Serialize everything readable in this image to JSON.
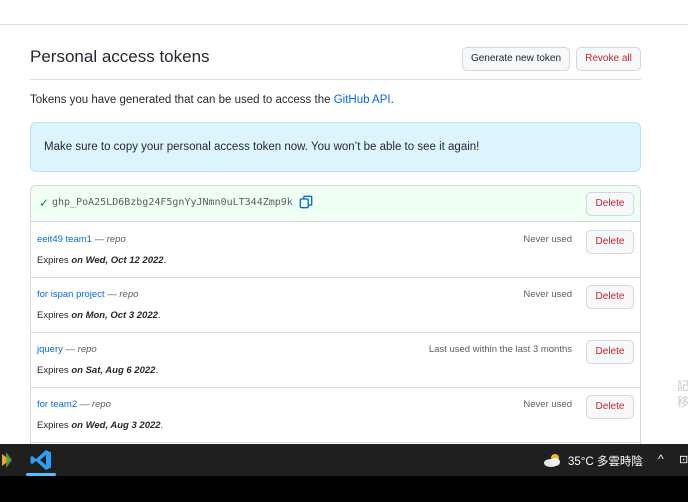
{
  "header": {
    "title": "Personal access tokens",
    "generate_label": "Generate new token",
    "revoke_label": "Revoke all"
  },
  "description": {
    "text": "Tokens you have generated that can be used to access the ",
    "link": "GitHub API",
    "suffix": "."
  },
  "flash": {
    "message": "Make sure to copy your personal access token now. You won’t be able to see it again!"
  },
  "new_token": {
    "value": "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",
    "delete_label": "Delete"
  },
  "tokens": [
    {
      "name": "eeit49 team1",
      "sep": " — repo",
      "usage": "Never used",
      "expires_prefix": "Expires ",
      "expires_date": "on Wed, Oct 12 2022",
      "expires_suffix": ".",
      "delete_label": "Delete"
    },
    {
      "name": "for ispan project",
      "sep": " — repo",
      "usage": "Never used",
      "expires_prefix": "Expires ",
      "expires_date": "on Mon, Oct 3 2022",
      "expires_suffix": ".",
      "delete_label": "Delete"
    },
    {
      "name": "jquery",
      "sep": " — repo",
      "usage": "Last used within the last 3 months",
      "expires_prefix": "Expires ",
      "expires_date": "on Sat, Aug 6 2022",
      "expires_suffix": ".",
      "delete_label": "Delete"
    },
    {
      "name": "for team2",
      "sep": " — repo",
      "usage": "Never used",
      "expires_prefix": "Expires ",
      "expires_date": "on Wed, Aug 3 2022",
      "expires_suffix": ".",
      "delete_label": "Delete"
    }
  ],
  "side": {
    "line1": "記",
    "line2": "移"
  },
  "taskbar": {
    "weather": "35°C 多雲時陰",
    "chevron": "^",
    "tray": "⊡"
  },
  "colors": {
    "link": "#0969da",
    "danger": "#cf222e",
    "success": "#1a7f37",
    "flash_bg": "#ddf4ff",
    "new_token_bg": "#f0fff4"
  },
  "icons": {
    "check": "check-icon",
    "copy": "copy-icon",
    "weather": "cloudy-weather-icon",
    "vscode": "vscode-icon",
    "app": "app-icon"
  }
}
